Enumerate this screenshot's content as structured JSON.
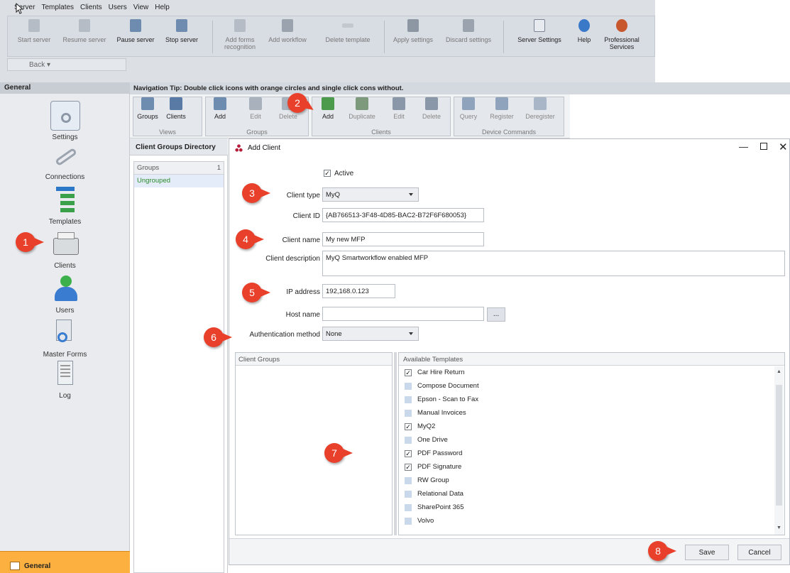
{
  "menu": [
    "Server",
    "Templates",
    "Clients",
    "Users",
    "View",
    "Help"
  ],
  "toolbar": {
    "buttons": [
      {
        "label": "Start server",
        "icon": "start-server-icon",
        "enabled": false
      },
      {
        "label": "Resume server",
        "icon": "resume-server-icon",
        "enabled": false
      },
      {
        "label": "Pause server",
        "icon": "pause-server-icon",
        "enabled": true
      },
      {
        "label": "Stop server",
        "icon": "stop-server-icon",
        "enabled": true
      },
      {
        "label": "Add forms recognition",
        "icon": "add-forms-icon",
        "enabled": false
      },
      {
        "label": "Add workflow",
        "icon": "add-workflow-icon",
        "enabled": false
      },
      {
        "label": "Delete template",
        "icon": "delete-template-icon",
        "enabled": false
      },
      {
        "label": "Apply settings",
        "icon": "apply-settings-icon",
        "enabled": false
      },
      {
        "label": "Discard settings",
        "icon": "discard-settings-icon",
        "enabled": false
      },
      {
        "label": "Server Settings",
        "icon": "server-settings-icon",
        "enabled": true
      },
      {
        "label": "Help",
        "icon": "help-icon",
        "enabled": true
      },
      {
        "label": "Professional Services",
        "icon": "professional-services-icon",
        "enabled": true
      }
    ],
    "back_label": "Back"
  },
  "left_panel": {
    "header": "General",
    "items": [
      {
        "label": "Settings",
        "icon": "settings-icon"
      },
      {
        "label": "Connections",
        "icon": "connections-icon"
      },
      {
        "label": "Templates",
        "icon": "templates-icon"
      },
      {
        "label": "Clients",
        "icon": "clients-icon"
      },
      {
        "label": "Users",
        "icon": "users-icon"
      },
      {
        "label": "Master Forms",
        "icon": "master-forms-icon"
      },
      {
        "label": "Log",
        "icon": "log-icon"
      }
    ],
    "footer": "General"
  },
  "nav_tip": "Navigation Tip: Double click icons with orange circles and single click cons without.",
  "ribbon": {
    "views": {
      "label": "Views",
      "buttons": [
        "Groups",
        "Clients"
      ]
    },
    "groups": {
      "label": "Groups",
      "buttons": [
        "Add",
        "Edit",
        "Delete"
      ]
    },
    "clients": {
      "label": "Clients",
      "buttons": [
        "Add",
        "Duplicate",
        "Edit",
        "Delete"
      ]
    },
    "device_commands": {
      "label": "Device Commands",
      "buttons": [
        "Query",
        "Register",
        "Deregister"
      ]
    }
  },
  "directory": {
    "title": "Client Groups Directory",
    "header": "Groups",
    "count": "1",
    "row": "Ungrouped"
  },
  "dialog": {
    "title": "Add Client",
    "active_label": "Active",
    "active_checked": true,
    "client_type_label": "Client type",
    "client_type_value": "MyQ",
    "client_id_label": "Client ID",
    "client_id_value": "{AB766513-3F48-4D85-BAC2-B72F6F680053}",
    "client_name_label": "Client name",
    "client_name_value": "My new MFP",
    "client_description_label": "Client description",
    "client_description_value": "MyQ Smartworkflow enabled MFP",
    "ip_label": "IP address",
    "ip_value": "192,168.0.123",
    "host_label": "Host name",
    "host_value": "",
    "dots_label": "...",
    "auth_label": "Authentication method",
    "auth_value": "None",
    "client_groups_header": "Client Groups",
    "available_templates_header": "Available Templates",
    "templates": [
      {
        "name": "Car Hire Return",
        "checked": true
      },
      {
        "name": "Compose Document",
        "checked": false
      },
      {
        "name": "Epson - Scan to Fax",
        "checked": false
      },
      {
        "name": "Manual Invoices",
        "checked": false
      },
      {
        "name": "MyQ2",
        "checked": true
      },
      {
        "name": "One Drive",
        "checked": false
      },
      {
        "name": "PDF Password",
        "checked": true
      },
      {
        "name": "PDF Signature",
        "checked": true
      },
      {
        "name": "RW Group",
        "checked": false
      },
      {
        "name": "Relational Data",
        "checked": false
      },
      {
        "name": "SharePoint 365",
        "checked": false
      },
      {
        "name": "Volvo",
        "checked": false
      }
    ],
    "save_label": "Save",
    "cancel_label": "Cancel"
  },
  "callouts": [
    "1",
    "2",
    "3",
    "4",
    "5",
    "6",
    "7",
    "8"
  ],
  "colors": {
    "callout": "#e8402a",
    "general_footer": "#fbb040",
    "ungrouped_text": "#2b8a2b"
  }
}
